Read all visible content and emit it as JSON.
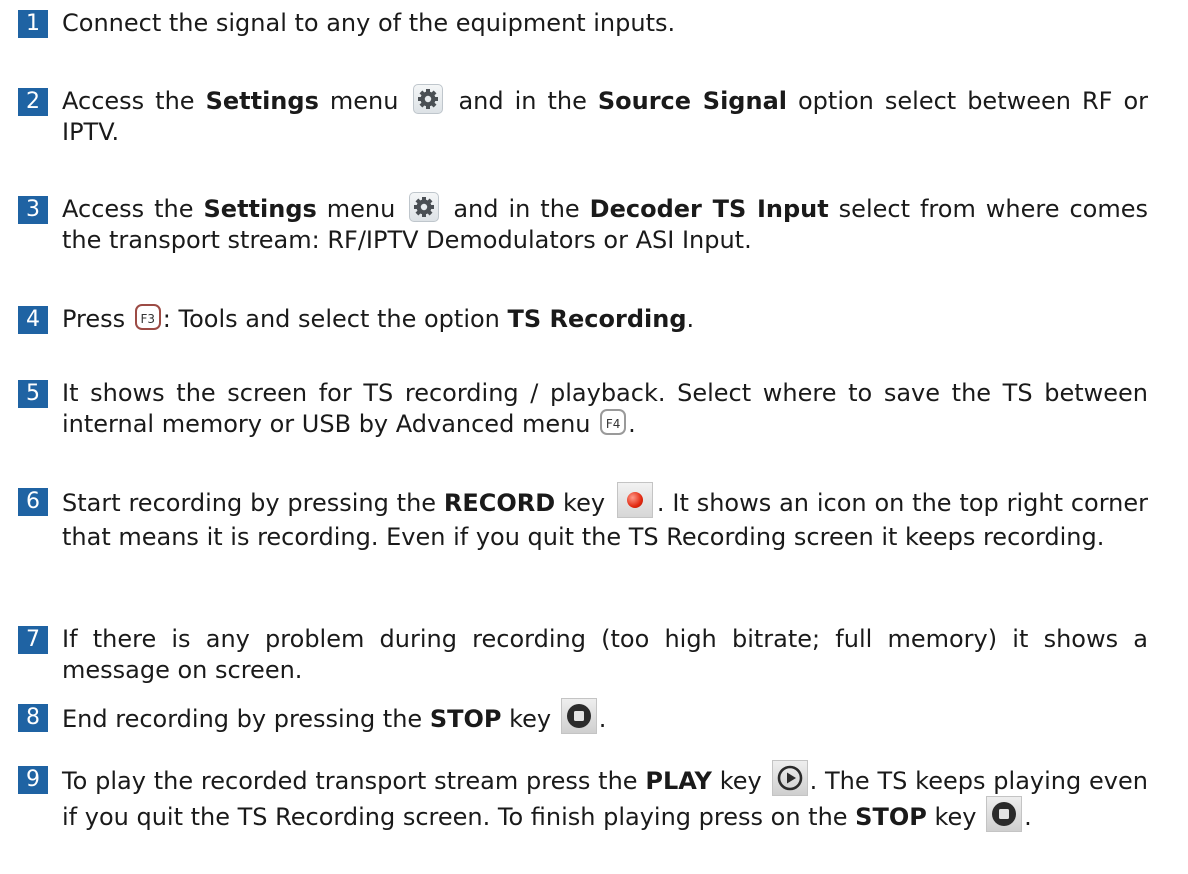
{
  "steps": [
    {
      "num": "1",
      "t1": "Connect the signal to any of the equipment inputs."
    },
    {
      "num": "2",
      "t1": "Access the ",
      "b1": "Settings",
      "t2": " menu ",
      "t3": " and in the ",
      "b2": "Source Signal",
      "t4": " option select between RF or IPTV."
    },
    {
      "num": "3",
      "t1": "Access the ",
      "b1": "Settings",
      "t2": " menu ",
      "t3": " and in the ",
      "b2": "Decoder TS Input",
      "t4": " select from where comes the transport stream: RF/IPTV Demodulators or ASI Input."
    },
    {
      "num": "4",
      "t1": "Press ",
      "key": "F3",
      "t2": ": Tools and select the option ",
      "b1": "TS Recording",
      "t3": "."
    },
    {
      "num": "5",
      "t1": "It shows the screen for TS recording / playback. Select where to save the TS between internal memory or USB by Advanced menu ",
      "key": "F4",
      "t2": "."
    },
    {
      "num": "6",
      "t1": "Start recording by pressing the ",
      "b1": "RECORD",
      "t2": " key ",
      "t3": ". It shows an icon on the top right corner that means it is recording. Even if you quit the TS Recording screen it keeps recording."
    },
    {
      "num": "7",
      "t1": "If there is any problem during recording (too high bitrate; full memory) it shows a message on screen."
    },
    {
      "num": "8",
      "t1": "End recording by pressing the ",
      "b1": "STOP",
      "t2": " key ",
      "t3": "."
    },
    {
      "num": "9",
      "t1": "To play the recorded transport stream press the ",
      "b1": "PLAY",
      "t2": " key ",
      "t3": ". The TS keeps playing even if you quit the TS Recording screen. To finish playing press on the ",
      "b2": "STOP",
      "t4": " key ",
      "t5": "."
    }
  ],
  "colors": {
    "badge": "#1f63a3",
    "record": "#e22a12"
  },
  "icons": [
    "gear-icon",
    "f3-key-icon",
    "f4-key-icon",
    "record-key-icon",
    "stop-key-icon",
    "play-key-icon"
  ]
}
